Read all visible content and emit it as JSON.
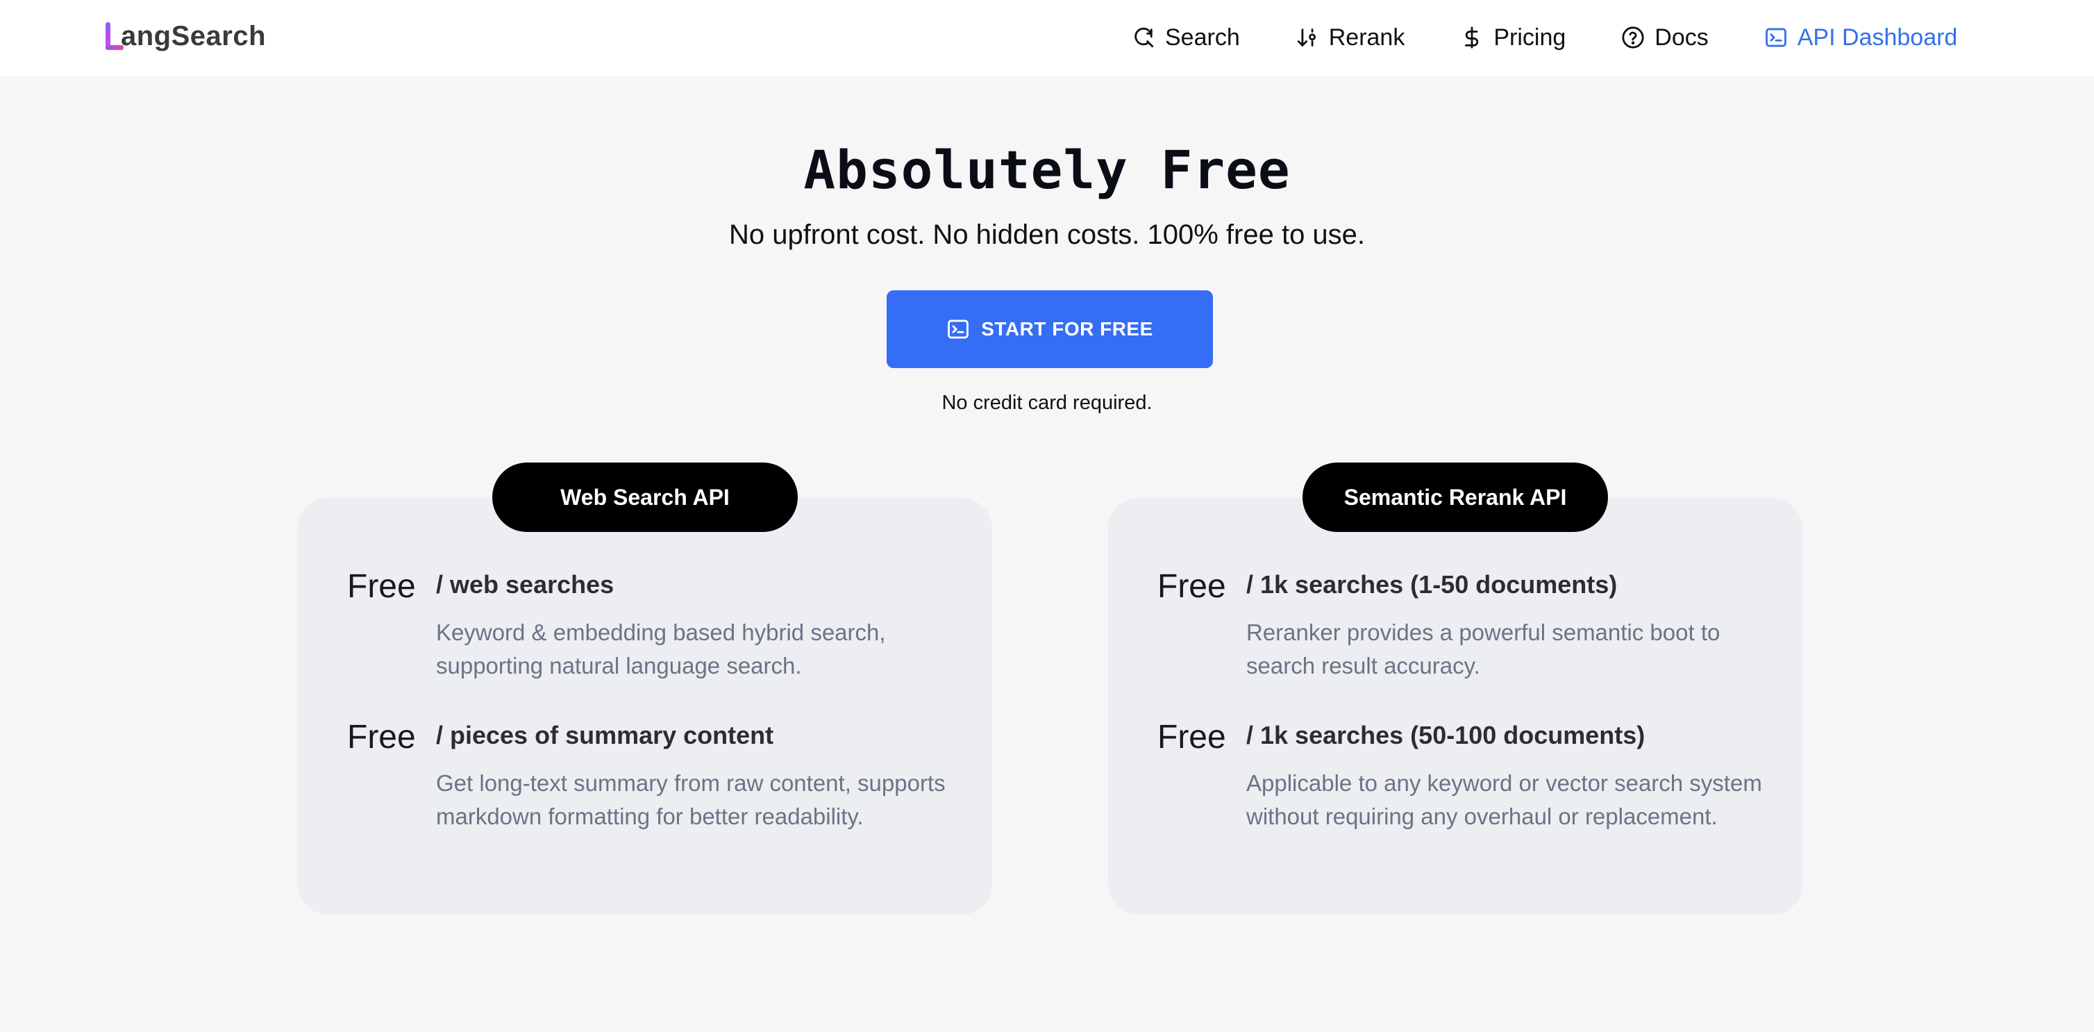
{
  "header": {
    "logo_text": "angSearch",
    "nav": [
      {
        "label": "Search",
        "icon": "search-icon"
      },
      {
        "label": "Rerank",
        "icon": "sort-icon"
      },
      {
        "label": "Pricing",
        "icon": "dollar-icon"
      },
      {
        "label": "Docs",
        "icon": "help-circle-icon"
      },
      {
        "label": "API Dashboard",
        "icon": "terminal-icon",
        "active": true
      }
    ]
  },
  "hero": {
    "title": "Absolutely Free",
    "subtitle": "No upfront cost. No hidden costs. 100% free to use.",
    "cta_label": "START FOR FREE",
    "cta_note": "No credit card required."
  },
  "cards": [
    {
      "title": "Web Search API",
      "features": [
        {
          "price": "Free",
          "plan": "/ web searches",
          "desc": "Keyword & embedding based hybrid search, supporting natural language search."
        },
        {
          "price": "Free",
          "plan": "/ pieces of summary content",
          "desc": "Get long-text summary from raw content, supports markdown formatting for better readability."
        }
      ]
    },
    {
      "title": "Semantic Rerank API",
      "features": [
        {
          "price": "Free",
          "plan": "/ 1k searches (1-50 documents)",
          "desc": "Reranker provides a powerful semantic boot to search result accuracy."
        },
        {
          "price": "Free",
          "plan": "/ 1k searches (50-100 documents)",
          "desc": "Applicable to any keyword or vector search system without requiring any overhaul or replacement."
        }
      ]
    }
  ],
  "colors": {
    "accent": "#356ef4",
    "active_nav": "#3370ee",
    "background": "#f6f6f7",
    "card_background": "#eceef1"
  }
}
